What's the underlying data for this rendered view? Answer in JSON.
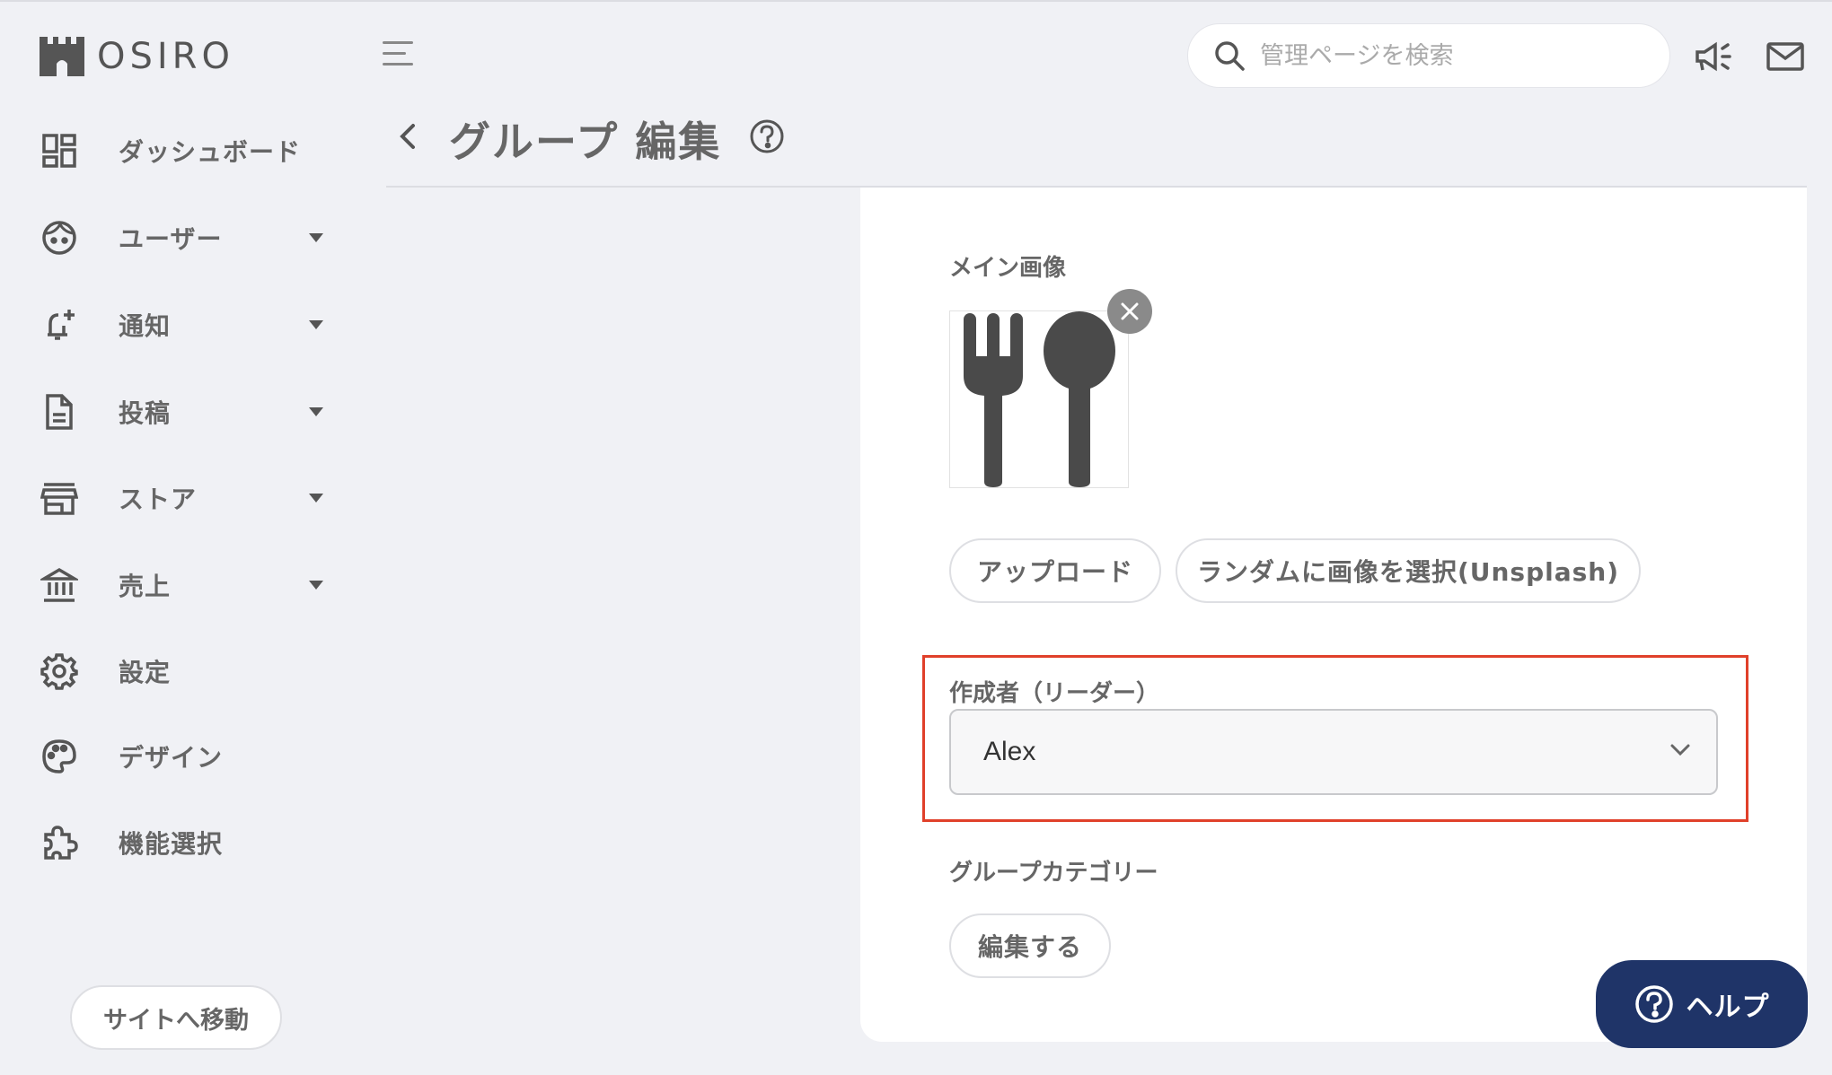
{
  "app": {
    "logo_text": "OSIRO"
  },
  "header": {
    "search": {
      "placeholder": "管理ページを検索",
      "value": ""
    },
    "page_title": "グループ 編集"
  },
  "sidebar": {
    "items": [
      {
        "label": "ダッシュボード",
        "icon": "dashboard-icon",
        "has_caret": false
      },
      {
        "label": "ユーザー",
        "icon": "user-face-icon",
        "has_caret": true
      },
      {
        "label": "通知",
        "icon": "bell-add-icon",
        "has_caret": true
      },
      {
        "label": "投稿",
        "icon": "document-icon",
        "has_caret": true
      },
      {
        "label": "ストア",
        "icon": "store-icon",
        "has_caret": true
      },
      {
        "label": "売上",
        "icon": "bank-icon",
        "has_caret": true
      },
      {
        "label": "設定",
        "icon": "gear-icon",
        "has_caret": false
      },
      {
        "label": "デザイン",
        "icon": "palette-icon",
        "has_caret": false
      },
      {
        "label": "機能選択",
        "icon": "puzzle-icon",
        "has_caret": false
      }
    ],
    "site_button": "サイトへ移動"
  },
  "form": {
    "main_image": {
      "label": "メイン画像",
      "image_icon": "fork-spoon-icon",
      "upload_button": "アップロード",
      "random_button": "ランダムに画像を選択(Unsplash)"
    },
    "creator": {
      "label": "作成者（リーダー）",
      "selected": "Alex"
    },
    "category": {
      "label": "グループカテゴリー",
      "edit_button": "編集する"
    }
  },
  "help_button": "ヘルプ",
  "colors": {
    "background": "#f0f1f5",
    "highlight": "#e0402a",
    "help_button": "#1f3468",
    "text": "#666666"
  }
}
